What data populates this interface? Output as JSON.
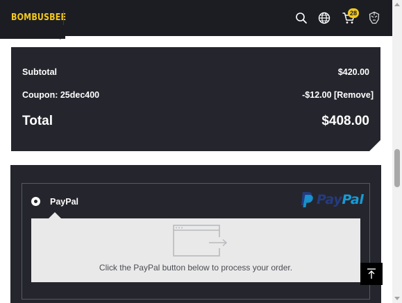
{
  "header": {
    "logo": "BOMBUSBEE",
    "cart_count": "28",
    "icons": [
      "search-icon",
      "globe-icon",
      "cart-icon",
      "account-helmet-icon"
    ]
  },
  "totals": {
    "subtotal_label": "Subtotal",
    "subtotal_value": "$420.00",
    "coupon_label": "Coupon: 25dec400",
    "coupon_value": "-$12.00",
    "remove_label": "[Remove]",
    "total_label": "Total",
    "total_value": "$408.00"
  },
  "payment": {
    "method_label": "PayPal",
    "logo_text_1": "Pay",
    "logo_text_2": "Pal",
    "info_text": "Click the PayPal button below to process your order."
  },
  "colors": {
    "accent": "#f3c81b",
    "card_bg": "#25262d",
    "header_bg": "#1c1d23",
    "paypal_dark": "#253b80",
    "paypal_light": "#179bd7"
  }
}
